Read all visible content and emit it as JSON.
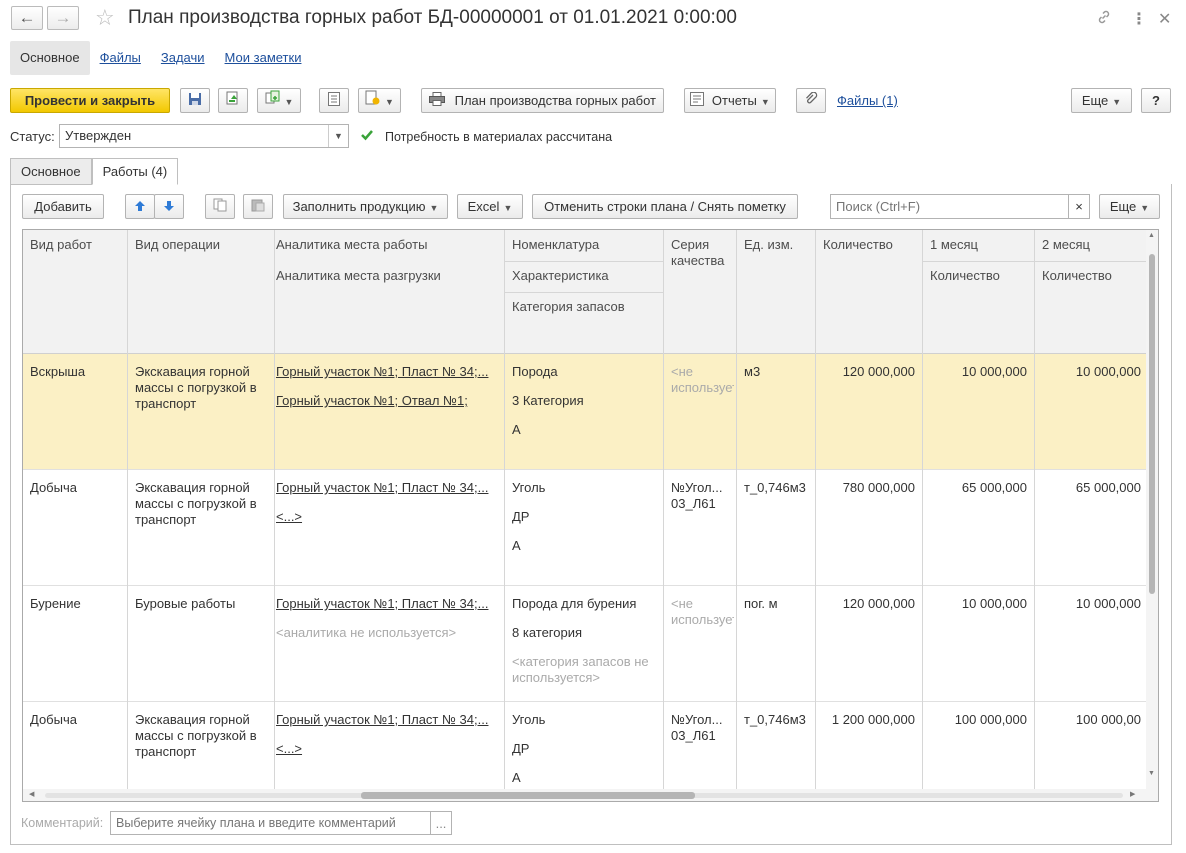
{
  "window": {
    "title": "План производства горных работ БД-00000001 от 01.01.2021 0:00:00",
    "nav_back": "←",
    "nav_forward": "→"
  },
  "sections": [
    "Основное",
    "Файлы",
    "Задачи",
    "Мои заметки"
  ],
  "toolbar": {
    "post_close": "Провести и закрыть",
    "plan_button": "План производства горных работ",
    "reports": "Отчеты",
    "files_link": "Файлы (1)",
    "more": "Еще",
    "help": "?"
  },
  "status": {
    "label": "Статус:",
    "value": "Утвержден",
    "check_text": "Потребность в материалах рассчитана"
  },
  "tabs": [
    "Основное",
    "Работы (4)"
  ],
  "table_toolbar": {
    "add": "Добавить",
    "fill": "Заполнить продукцию",
    "excel": "Excel",
    "cancel_rows": "Отменить строки плана / Снять пометку",
    "search_placeholder": "Поиск (Ctrl+F)",
    "clear": "×",
    "more": "Еще"
  },
  "columns": {
    "work_type": "Вид работ",
    "operation": "Вид операции",
    "place": "Аналитика места работы",
    "unload": "Аналитика места разгрузки",
    "nomenclature": "Номенклатура",
    "characteristic": "Характеристика",
    "stock_category": "Категория запасов",
    "series": "Серия качества",
    "unit": "Ед. изм.",
    "quantity": "Количество",
    "month1": "1 месяц",
    "month1_qty": "Количество",
    "month2": "2 месяц",
    "month2_qty": "Количество"
  },
  "rows": [
    {
      "work_type": "Вскрыша",
      "operation": "Экскавация горной массы с погрузкой в транспорт",
      "place": "Горный участок №1; Пласт № 34;...",
      "unload": "Горный участок №1; Отвал №1;",
      "nomenclature": "Порода",
      "characteristic": "3 Категория",
      "stock_category": "А",
      "series": "<не используется>",
      "unit": "м3",
      "quantity": "120 000,000",
      "m1": "10 000,000",
      "m2": "10 000,000"
    },
    {
      "work_type": "Добыча",
      "operation": "Экскавация горной массы с погрузкой в транспорт",
      "place": "Горный участок №1; Пласт № 34;...",
      "unload": "<...>",
      "nomenclature": "Уголь",
      "characteristic": "ДР",
      "stock_category": "А",
      "series": "№Угол... 03_Л61",
      "unit": "т_0,746м3",
      "quantity": "780 000,000",
      "m1": "65 000,000",
      "m2": "65 000,000"
    },
    {
      "work_type": "Бурение",
      "operation": "Буровые работы",
      "place": "Горный участок №1; Пласт № 34;...",
      "unload": "<аналитика не используется>",
      "nomenclature": "Порода для бурения",
      "characteristic": "8 категория",
      "stock_category": "<категория запасов не используется>",
      "series": "<не используется>",
      "unit": "пог. м",
      "quantity": "120 000,000",
      "m1": "10 000,000",
      "m2": "10 000,000"
    },
    {
      "work_type": "Добыча",
      "operation": "Экскавация горной массы с погрузкой в транспорт",
      "place": "Горный участок №1; Пласт № 34;...",
      "unload": "<...>",
      "nomenclature": "Уголь",
      "characteristic": "ДР",
      "stock_category": "А",
      "series": "№Угол... 03_Л61",
      "unit": "т_0,746м3",
      "quantity": "1 200 000,000",
      "m1": "100 000,000",
      "m2": "100 000,00"
    }
  ],
  "comment": {
    "label": "Комментарий:",
    "placeholder": "Выберите ячейку плана и введите комментарий",
    "button": "..."
  }
}
